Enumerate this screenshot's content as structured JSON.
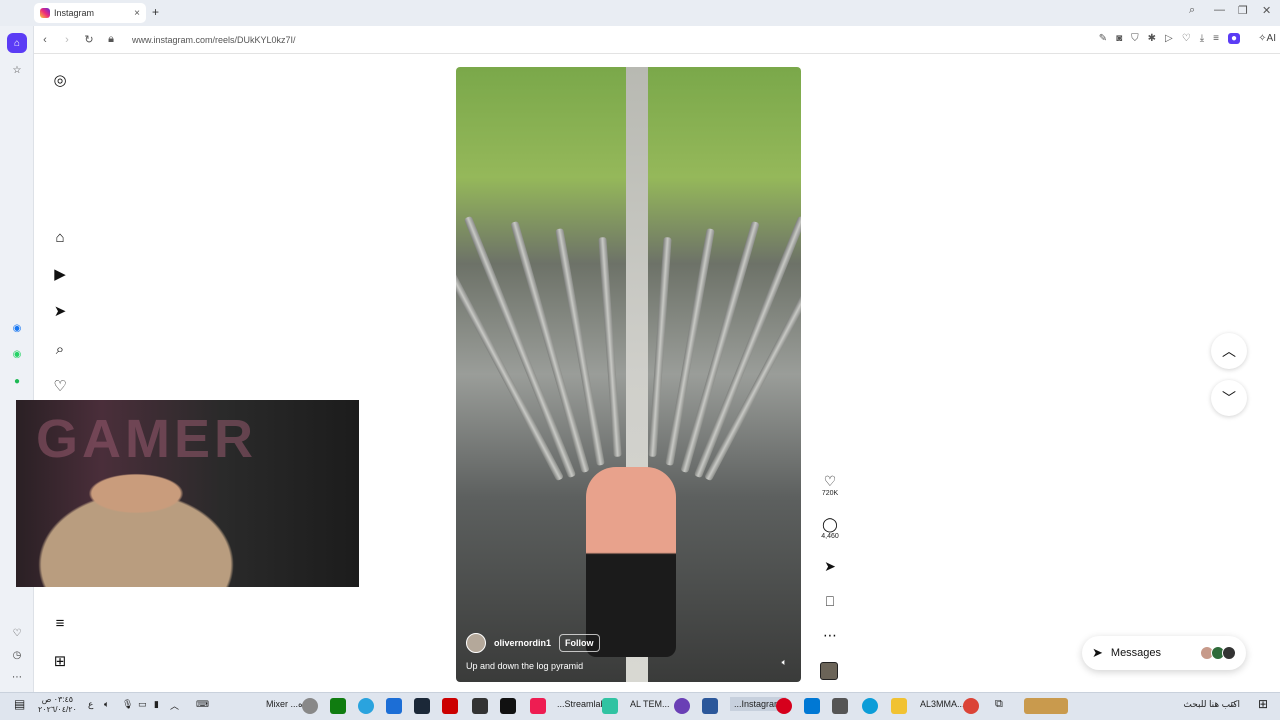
{
  "browser": {
    "tab_title": "Instagram",
    "tab_close": "×",
    "new_tab": "+",
    "url": "www.instagram.com/reels/DUkKYL0kz7I/",
    "ai_label": "AI"
  },
  "reel": {
    "author": "olivernordin1",
    "follow_label": "Follow",
    "caption": "Up and down the log pyramid",
    "mute_icon": "volume-icon"
  },
  "actions": {
    "like_count": "720K",
    "comment_count": "4,460"
  },
  "messages": {
    "label": "Messages"
  },
  "taskbar": {
    "time": "٠٣:٤٥ ص",
    "date": "٢٠٢٦/٠٤/٢٠",
    "lang": "ع",
    "mixer_label": "Mixer ...ه",
    "streamlabs_label": "...Streamlab",
    "altem_label": "AL TEM...",
    "instagram_label": "...Instagram",
    "al3mma_label": "AL3MMA...",
    "search_placeholder": "اكتب هنا للبحث"
  },
  "colors": {
    "opera_red": "#d6001c",
    "opera_accent": "#5b3cf5",
    "instagram_gradient": [
      "#f9ce34",
      "#ee2a7b",
      "#6228d7"
    ]
  }
}
